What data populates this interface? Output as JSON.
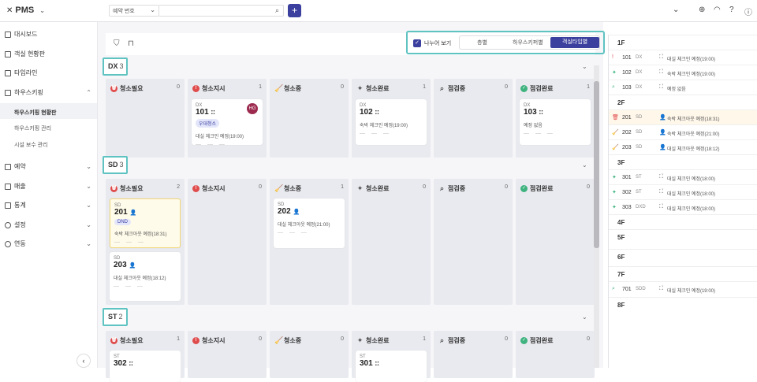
{
  "app": {
    "title": "PMS"
  },
  "search": {
    "select_value": "예약 번호",
    "placeholder": ""
  },
  "sidebar": {
    "items": [
      {
        "label": "대시보드"
      },
      {
        "label": "객실 현황판"
      },
      {
        "label": "타임라인"
      },
      {
        "label": "하우스키핑"
      },
      {
        "label": "예약"
      },
      {
        "label": "매출"
      },
      {
        "label": "통계"
      },
      {
        "label": "설정"
      },
      {
        "label": "연동"
      }
    ],
    "subitems": [
      {
        "label": "하우스키핑 현황판"
      },
      {
        "label": "하우스키핑 관리"
      },
      {
        "label": "시설 보수 관리"
      }
    ]
  },
  "toolbar": {
    "split_label": "나누어 보기",
    "segments": [
      "층별",
      "하우스키퍼별",
      "객실타입별"
    ]
  },
  "columns": [
    "청소필요",
    "청소지시",
    "청소중",
    "청소완료",
    "점검중",
    "점검완료"
  ],
  "groups": [
    {
      "name": "DX",
      "count": "3",
      "col_counts": [
        "0",
        "1",
        "0",
        "1",
        "0",
        "1"
      ]
    },
    {
      "name": "SD",
      "count": "3",
      "col_counts": [
        "2",
        "0",
        "1",
        "0",
        "0",
        "0"
      ]
    },
    {
      "name": "ST",
      "count": "2",
      "col_counts": [
        "1",
        "0",
        "0",
        "1",
        "0",
        "0"
      ]
    }
  ],
  "cards": {
    "dx_101": {
      "type": "DX",
      "room": "101",
      "badge": "우대청소",
      "note": "대실 체크인 예정(19:00)",
      "avatar": "HG"
    },
    "dx_102": {
      "type": "DX",
      "room": "102",
      "note": "숙박 체크인 예정(19:00)"
    },
    "dx_103": {
      "type": "DX",
      "room": "103",
      "note": "예정 없음"
    },
    "sd_201": {
      "type": "SD",
      "room": "201",
      "badge": "DND",
      "note": "숙박 체크아웃 예정(18:31)"
    },
    "sd_203": {
      "type": "SD",
      "room": "203",
      "note": "대실 체크아웃 예정(18:12)"
    },
    "sd_202": {
      "type": "SD",
      "room": "202",
      "note": "대실 체크아웃 예정(21:00)"
    },
    "st_302": {
      "type": "ST",
      "room": "302"
    },
    "st_301": {
      "type": "ST",
      "room": "301"
    },
    "dash": "— — —"
  },
  "right_panel": {
    "floors": [
      "1F",
      "2F",
      "3F",
      "4F",
      "5F",
      "6F",
      "7F",
      "8F"
    ],
    "rows": [
      {
        "room": "101",
        "type": "DX",
        "status": "대실 체크인 예정(19:00)"
      },
      {
        "room": "102",
        "type": "DX",
        "status": "숙박 체크인 예정(19:00)"
      },
      {
        "room": "103",
        "type": "DX",
        "status": "예정 없음"
      },
      {
        "room": "201",
        "type": "SD",
        "status": "숙박 체크아웃 예정(18:31)"
      },
      {
        "room": "202",
        "type": "SD",
        "status": "숙박 체크아웃 예정(21:00)"
      },
      {
        "room": "203",
        "type": "SD",
        "status": "대실 체크아웃 예정(18:12)"
      },
      {
        "room": "301",
        "type": "ST",
        "status": "대실 체크인 예정(18:00)"
      },
      {
        "room": "302",
        "type": "ST",
        "status": "대실 체크인 예정(18:00)"
      },
      {
        "room": "303",
        "type": "DXD",
        "status": "대실 체크인 예정(18:00)"
      },
      {
        "room": "701",
        "type": "SDD",
        "status": "대실 체크인 예정(19:00)"
      }
    ]
  },
  "colors": {
    "accent": "#3b3f9e",
    "highlight": "#5fc3c2",
    "red": "#e04b4b",
    "green": "#3fb37f"
  }
}
